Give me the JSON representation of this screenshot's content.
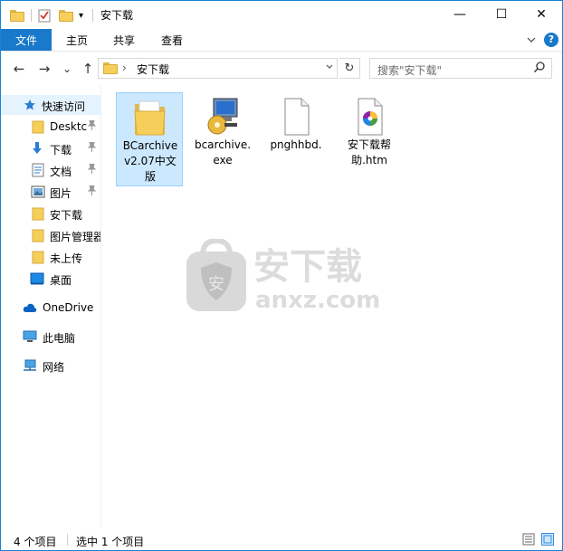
{
  "window": {
    "title": "安下载"
  },
  "window_controls": {
    "minimize": "—",
    "maximize": "☐",
    "close": "✕"
  },
  "ribbon": {
    "tabs": [
      "文件",
      "主页",
      "共享",
      "查看"
    ],
    "expand_icon": "chevron-down-icon",
    "help_label": "?"
  },
  "nav": {
    "back": "←",
    "forward": "→",
    "recent": "⌄",
    "up": "↑",
    "breadcrumb_sep": "›",
    "path": [
      "安下载"
    ],
    "refresh": "↻",
    "search_placeholder": "搜索\"安下载\"",
    "search_icon": "⚲"
  },
  "sidebar": {
    "items": [
      {
        "label": "快速访问",
        "icon": "star-icon",
        "pinned": false
      },
      {
        "label": "Desktc",
        "icon": "folder-icon",
        "pinned": true
      },
      {
        "label": "下载",
        "icon": "download-icon",
        "pinned": true
      },
      {
        "label": "文档",
        "icon": "document-icon",
        "pinned": true
      },
      {
        "label": "图片",
        "icon": "picture-icon",
        "pinned": true
      },
      {
        "label": "安下载",
        "icon": "folder-icon",
        "pinned": false
      },
      {
        "label": "图片管理器",
        "icon": "folder-icon",
        "pinned": false
      },
      {
        "label": "未上传",
        "icon": "folder-icon",
        "pinned": false
      },
      {
        "label": "桌面",
        "icon": "desktop-icon",
        "pinned": false
      },
      {
        "label": "OneDrive",
        "icon": "cloud-icon",
        "pinned": false
      },
      {
        "label": "此电脑",
        "icon": "computer-icon",
        "pinned": false
      },
      {
        "label": "网络",
        "icon": "network-icon",
        "pinned": false
      }
    ],
    "pin_glyph": "📌"
  },
  "files": [
    {
      "name": "BCarchive v2.07中文版",
      "lines": [
        "BCarchive",
        "v2.07中文",
        "版"
      ],
      "type": "folder",
      "selected": true
    },
    {
      "name": "bcarchive.exe",
      "lines": [
        "bcarchive.",
        "exe"
      ],
      "type": "exe",
      "selected": false
    },
    {
      "name": "pnghhbd.",
      "lines": [
        "pnghhbd."
      ],
      "type": "blank",
      "selected": false
    },
    {
      "name": "安下载帮助.htm",
      "lines": [
        "安下载帮",
        "助.htm"
      ],
      "type": "htm",
      "selected": false
    }
  ],
  "watermark": {
    "title": "安下载",
    "url": "anxz.com",
    "shield_char": "安"
  },
  "status": {
    "count": "4 个项目",
    "selection": "选中 1 个项目"
  },
  "colors": {
    "accent": "#1979ca",
    "selection": "#cce8ff",
    "folder": "#f5cf5a",
    "border": "#1883d7"
  }
}
